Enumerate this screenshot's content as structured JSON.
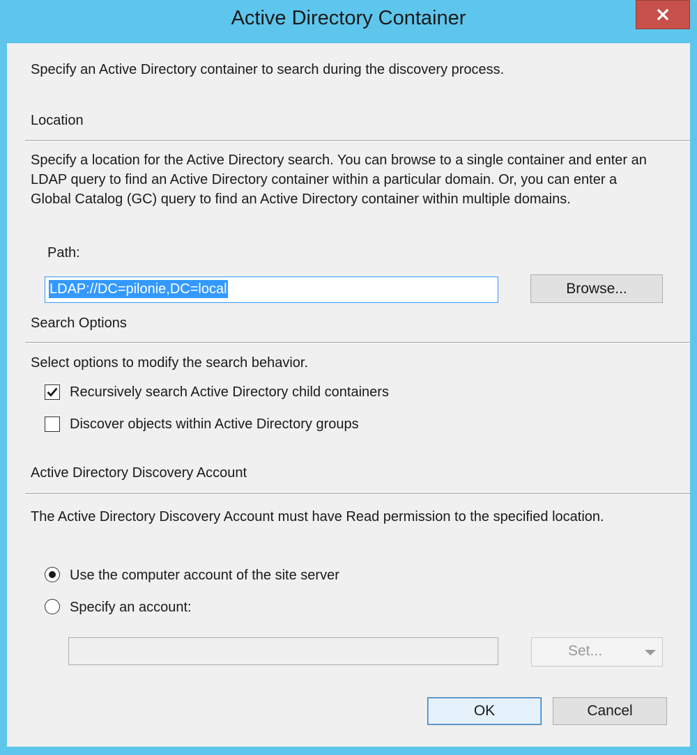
{
  "window": {
    "title": "Active Directory Container",
    "close_icon": "close-icon"
  },
  "intro": "Specify an Active Directory container to search during the discovery process.",
  "location": {
    "heading": "Location",
    "description": "Specify a location for the Active Directory search. You can browse to a single container and enter an LDAP query to find an Active Directory container within a particular domain. Or, you can enter a Global Catalog (GC) query to find an Active Directory container within multiple domains.",
    "path_label": "Path:",
    "path_value": "LDAP://DC=pilonie,DC=local",
    "browse_label": "Browse..."
  },
  "search_options": {
    "heading": "Search Options",
    "description": "Select options to modify the search behavior.",
    "options": [
      {
        "label": "Recursively search Active Directory child containers",
        "checked": true
      },
      {
        "label": "Discover objects within Active Directory groups",
        "checked": false
      }
    ]
  },
  "account": {
    "heading": "Active Directory Discovery Account",
    "description": "The Active Directory Discovery Account must have Read permission to the specified location.",
    "options": [
      {
        "label": "Use the computer account of the site server",
        "selected": true
      },
      {
        "label": "Specify an account:",
        "selected": false
      }
    ],
    "account_value": "",
    "set_label": "Set..."
  },
  "footer": {
    "ok_label": "OK",
    "cancel_label": "Cancel"
  },
  "colors": {
    "title_bar": "#5ec6ec",
    "close_button": "#c7504a",
    "dialog_bg": "#f0f0f0",
    "selection": "#3399ff"
  }
}
